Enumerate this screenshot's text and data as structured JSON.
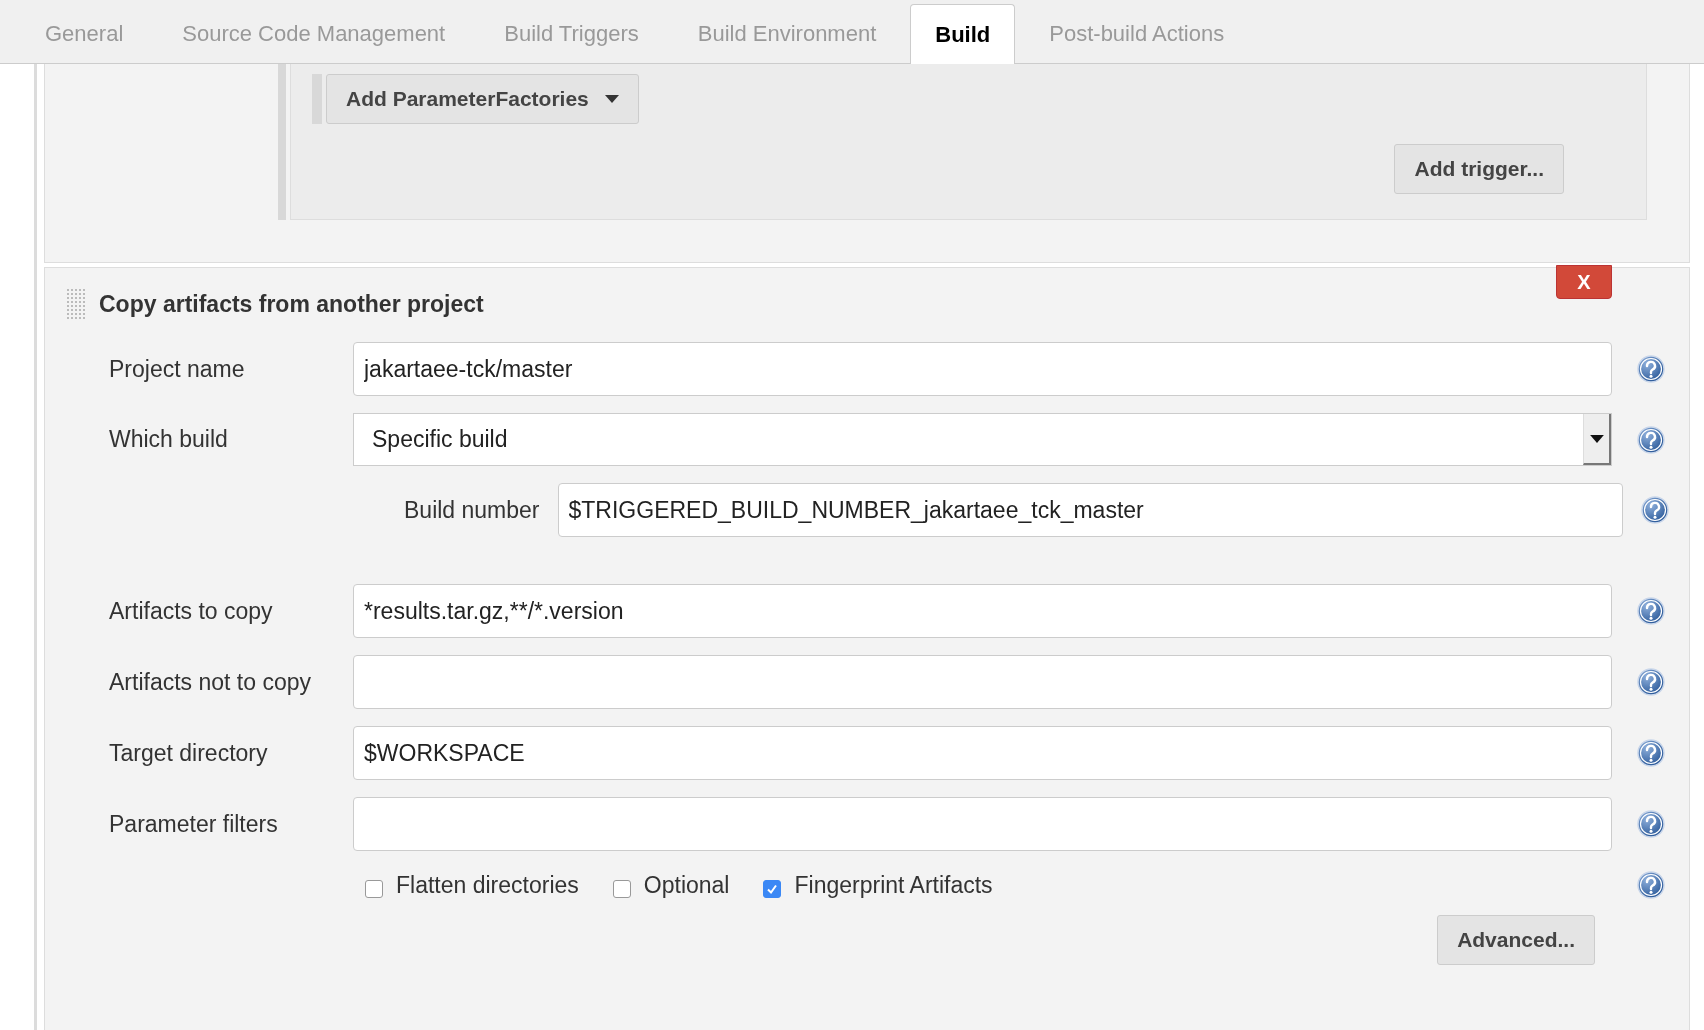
{
  "tabs": [
    {
      "label": "General",
      "selected": false
    },
    {
      "label": "Source Code Management",
      "selected": false
    },
    {
      "label": "Build Triggers",
      "selected": false
    },
    {
      "label": "Build Environment",
      "selected": false
    },
    {
      "label": "Build",
      "selected": true
    },
    {
      "label": "Post-build Actions",
      "selected": false
    }
  ],
  "trigger_panel": {
    "add_parameter_factories_button": "Add ParameterFactories",
    "add_trigger_button": "Add trigger..."
  },
  "build_step": {
    "title": "Copy artifacts from another project",
    "delete_button": "X",
    "fields": [
      {
        "label": "Project name",
        "kind": "text",
        "value": "jakartaee-tck/master"
      },
      {
        "label": "Which build",
        "kind": "select",
        "value": "Specific build"
      },
      {
        "label": "Build number",
        "kind": "subtext",
        "value": "$TRIGGERED_BUILD_NUMBER_jakartaee_tck_master"
      },
      {
        "label": "Artifacts to copy",
        "kind": "text",
        "value": "*results.tar.gz,**/*.version"
      },
      {
        "label": "Artifacts not to copy",
        "kind": "text"
      },
      {
        "label": "Target directory",
        "kind": "text",
        "value": "$WORKSPACE"
      },
      {
        "label": "Parameter filters",
        "kind": "text"
      }
    ],
    "options": [
      {
        "label": "Flatten directories",
        "checked": false
      },
      {
        "label": "Optional",
        "checked": false
      },
      {
        "label": "Fingerprint Artifacts",
        "checked": true
      }
    ],
    "advanced_button": "Advanced..."
  }
}
